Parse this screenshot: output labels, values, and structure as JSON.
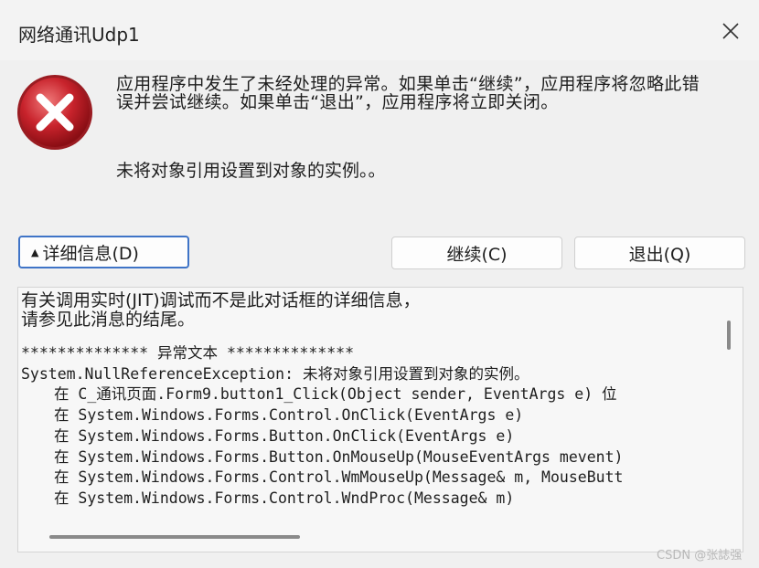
{
  "window": {
    "title": "网络通讯Udp1"
  },
  "message": {
    "main": "应用程序中发生了未经处理的异常。如果单击“继续”，应用程序将忽略此错误并尝试继续。如果单击“退出”，应用程序将立即关闭。",
    "detail": "未将对象引用设置到对象的实例。。"
  },
  "buttons": {
    "details": "详细信息(D)",
    "continue": "继续(C)",
    "quit": "退出(Q)"
  },
  "details": {
    "intro_line1": "有关调用实时(JIT)调试而不是此对话框的详细信息，",
    "intro_line2": "请参见此消息的结尾。",
    "section_header": "************** 异常文本 **************",
    "exception": "System.NullReferenceException: 未将对象引用设置到对象的实例。",
    "stack": [
      "在 C_通讯页面.Form9.button1_Click(Object sender, EventArgs e) 位",
      "在 System.Windows.Forms.Control.OnClick(EventArgs e)",
      "在 System.Windows.Forms.Button.OnClick(EventArgs e)",
      "在 System.Windows.Forms.Button.OnMouseUp(MouseEventArgs mevent)",
      "在 System.Windows.Forms.Control.WmMouseUp(Message& m, MouseButt",
      "在 System.Windows.Forms.Control.WndProc(Message& m)"
    ]
  },
  "watermark": "CSDN @张誌强",
  "colors": {
    "focus_border": "#3f74c7",
    "icon_red": "#c8232c"
  },
  "icons": {
    "error": "error-icon",
    "close": "close-icon",
    "expand": "triangle-up-icon"
  }
}
